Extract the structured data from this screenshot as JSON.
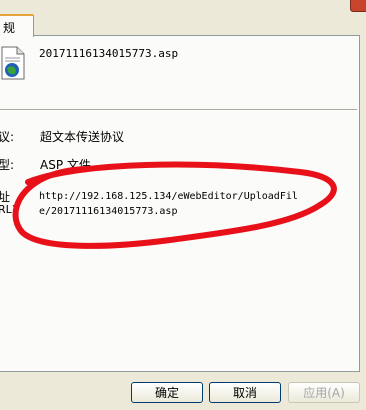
{
  "tab": {
    "label": "规"
  },
  "file": {
    "name": "20171116134015773.asp"
  },
  "rows": [
    {
      "label": "议:",
      "value": "超文本传送协议"
    },
    {
      "label": "型:",
      "value": "ASP 文件"
    },
    {
      "label": "址",
      "label2": "RL)"
    }
  ],
  "url": "http://192.168.125.134/eWebEditor/UploadFile/20171116134015773.asp",
  "buttons": {
    "ok": "确定",
    "cancel": "取消",
    "apply": "应用(A)"
  },
  "icons": {
    "file": "asp-file-icon"
  },
  "colors": {
    "annotation": "#e8111a",
    "tab_highlight": "#e6a23c"
  }
}
